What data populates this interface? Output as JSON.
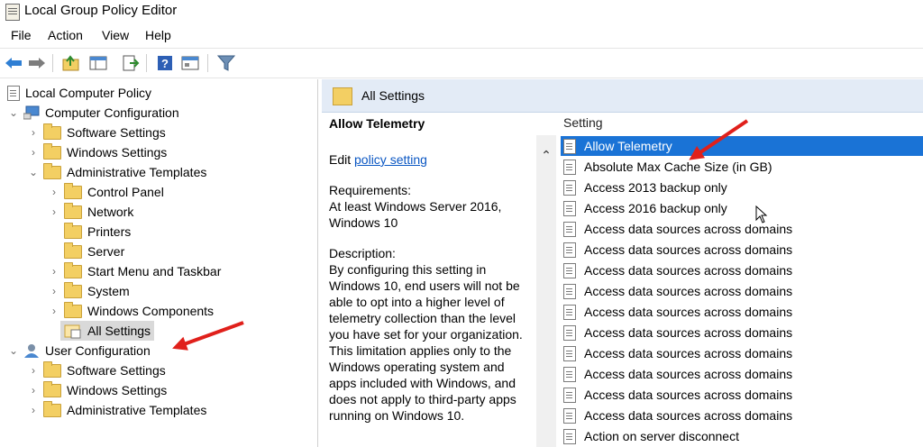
{
  "window": {
    "title": "Local Group Policy Editor"
  },
  "menu": [
    "File",
    "Action",
    "View",
    "Help"
  ],
  "toolbar": {
    "icons": [
      "back-arrow-icon",
      "forward-arrow-icon",
      "up-folder-icon",
      "show-hide-tree-icon",
      "export-list-icon",
      "help-icon",
      "properties-icon",
      "filter-icon"
    ],
    "accent": "#1a73d6"
  },
  "tree": {
    "root": "Local Computer Policy",
    "computer_config": "Computer Configuration",
    "cc_items": [
      "Software Settings",
      "Windows Settings",
      "Administrative Templates"
    ],
    "admin_templates": [
      "Control Panel",
      "Network",
      "Printers",
      "Server",
      "Start Menu and Taskbar",
      "System",
      "Windows Components",
      "All Settings"
    ],
    "user_config": "User Configuration",
    "uc_items": [
      "Software Settings",
      "Windows Settings",
      "Administrative Templates"
    ]
  },
  "right": {
    "header": "All Settings",
    "desc_title": "Allow Telemetry",
    "edit_prefix": "Edit ",
    "edit_link": "policy setting",
    "requirements": "Requirements:\nAt least Windows Server 2016, Windows 10",
    "description": "Description:\nBy configuring this setting in Windows 10, end users will not be able to opt into a higher level of telemetry collection than the level you have set for your organization.  This limitation applies only to the Windows operating system and apps included with Windows, and does not apply to third-party apps running on Windows 10.",
    "column_header": "Setting",
    "settings": [
      "Allow Telemetry",
      "Absolute Max Cache Size (in GB)",
      "Access 2013 backup only",
      "Access 2016 backup only",
      "Access data sources across domains",
      "Access data sources across domains",
      "Access data sources across domains",
      "Access data sources across domains",
      "Access data sources across domains",
      "Access data sources across domains",
      "Access data sources across domains",
      "Access data sources across domains",
      "Access data sources across domains",
      "Access data sources across domains",
      "Action on server disconnect"
    ]
  }
}
